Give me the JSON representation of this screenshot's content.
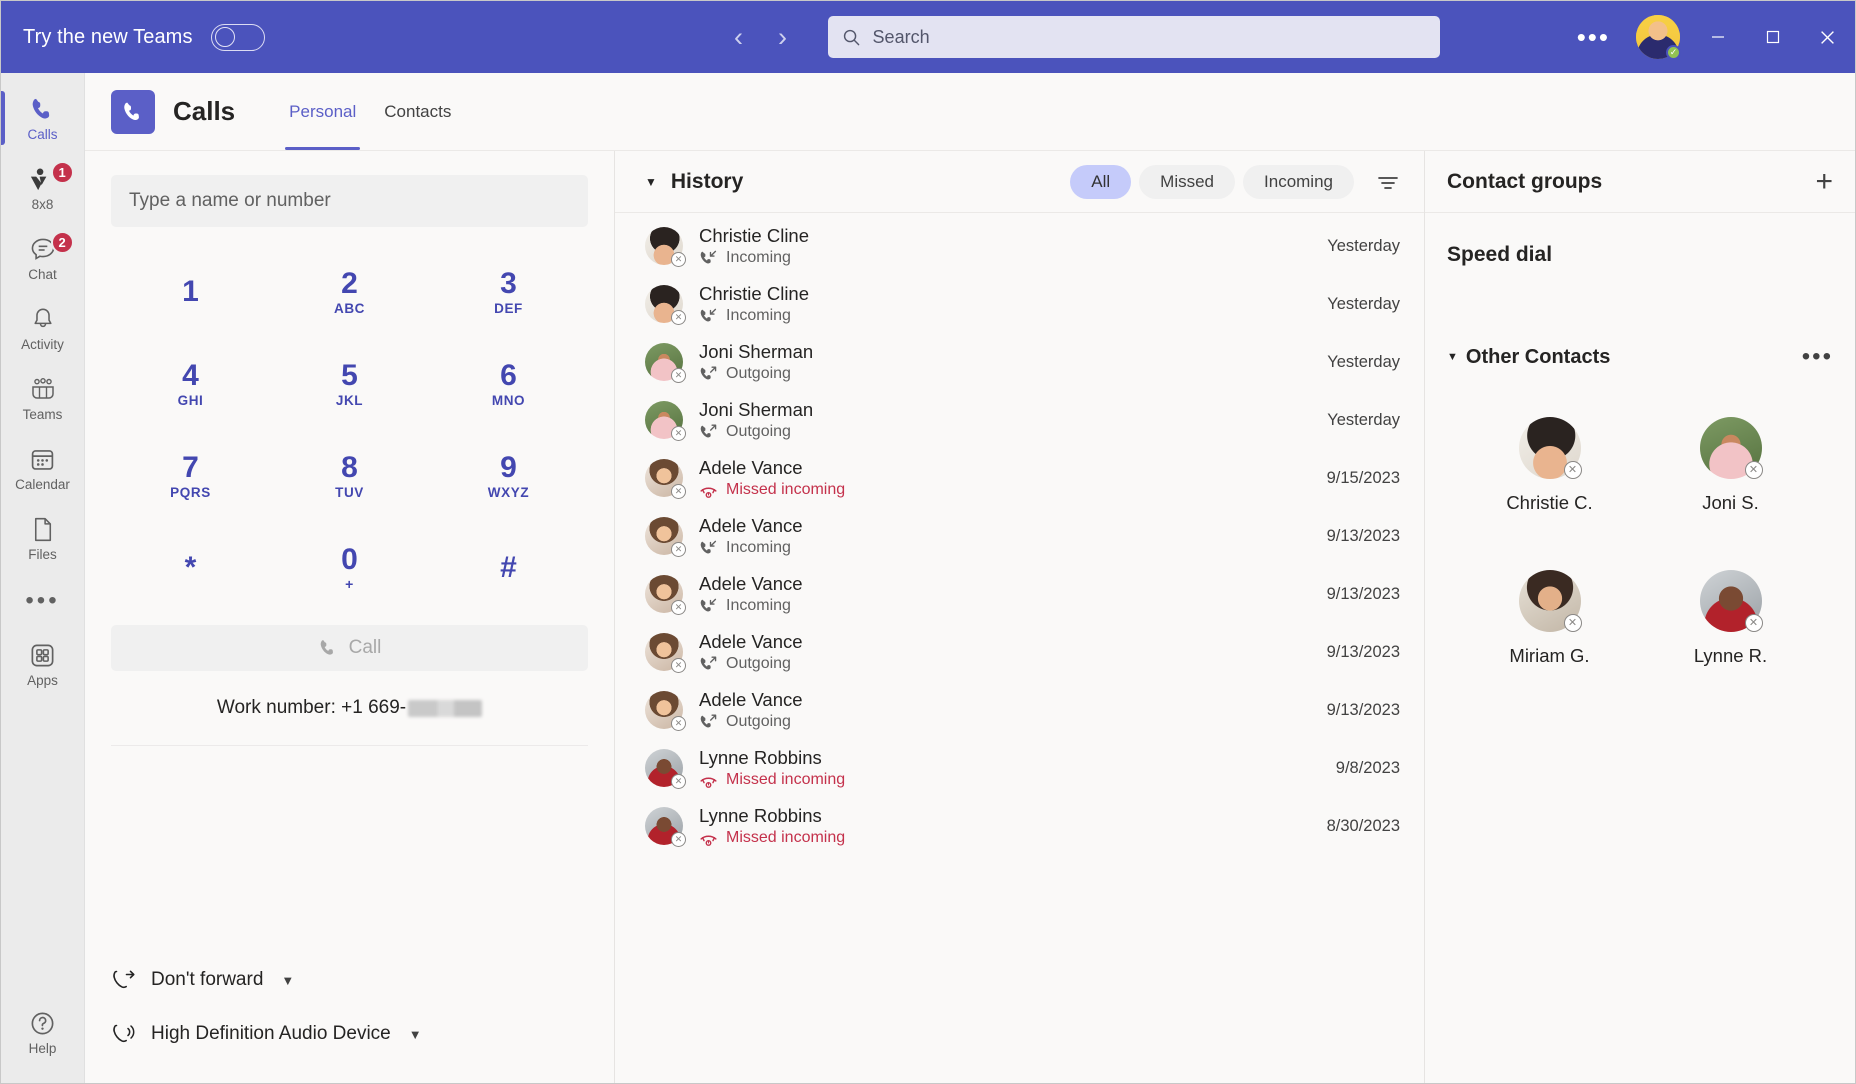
{
  "titlebar": {
    "try_new_label": "Try the new Teams",
    "toggle_state": "off",
    "back_icon": "chevron-left-icon",
    "forward_icon": "chevron-right-icon",
    "search_placeholder": "Search",
    "more_label": "•••",
    "minimize_label": "─",
    "maximize_label": "☐",
    "close_label": "✕",
    "brand_color": "#4b53bc"
  },
  "rail": {
    "items": [
      {
        "label": "Calls",
        "icon": "phone-icon",
        "active": true,
        "badge": ""
      },
      {
        "label": "8x8",
        "icon": "people-icon",
        "active": false,
        "badge": "1"
      },
      {
        "label": "Chat",
        "icon": "chat-icon",
        "active": false,
        "badge": "2"
      },
      {
        "label": "Activity",
        "icon": "bell-icon",
        "active": false,
        "badge": ""
      },
      {
        "label": "Teams",
        "icon": "teams-icon",
        "active": false,
        "badge": ""
      },
      {
        "label": "Calendar",
        "icon": "calendar-icon",
        "active": false,
        "badge": ""
      },
      {
        "label": "Files",
        "icon": "file-icon",
        "active": false,
        "badge": ""
      }
    ],
    "overflow_label": "•••",
    "apps_label": "Apps",
    "help_label": "Help"
  },
  "app_header": {
    "title": "Calls",
    "logo_icon": "phone-icon",
    "tabs": [
      {
        "label": "Personal",
        "active": true
      },
      {
        "label": "Contacts",
        "active": false
      }
    ]
  },
  "dialpad": {
    "input_placeholder": "Type a name or number",
    "input_value": "",
    "keys": [
      {
        "num": "1",
        "sub": ""
      },
      {
        "num": "2",
        "sub": "ABC"
      },
      {
        "num": "3",
        "sub": "DEF"
      },
      {
        "num": "4",
        "sub": "GHI"
      },
      {
        "num": "5",
        "sub": "JKL"
      },
      {
        "num": "6",
        "sub": "MNO"
      },
      {
        "num": "7",
        "sub": "PQRS"
      },
      {
        "num": "8",
        "sub": "TUV"
      },
      {
        "num": "9",
        "sub": "WXYZ"
      },
      {
        "num": "*",
        "sub": ""
      },
      {
        "num": "0",
        "sub": "+"
      },
      {
        "num": "#",
        "sub": ""
      }
    ],
    "call_button_label": "Call",
    "call_button_enabled": false,
    "work_number_label": "Work number: +1 669-",
    "work_number_redacted": true,
    "forwarding_label": "Don't forward",
    "audio_device_label": "High Definition Audio Device"
  },
  "history": {
    "title": "History",
    "filters": [
      {
        "label": "All",
        "active": true
      },
      {
        "label": "Missed",
        "active": false
      },
      {
        "label": "Incoming",
        "active": false
      }
    ],
    "filter_icon": "filter-icon",
    "rows": [
      {
        "name": "Christie Cline",
        "type": "Incoming",
        "missed": false,
        "time": "Yesterday",
        "avatar": "christie"
      },
      {
        "name": "Christie Cline",
        "type": "Incoming",
        "missed": false,
        "time": "Yesterday",
        "avatar": "christie"
      },
      {
        "name": "Joni Sherman",
        "type": "Outgoing",
        "missed": false,
        "time": "Yesterday",
        "avatar": "joni"
      },
      {
        "name": "Joni Sherman",
        "type": "Outgoing",
        "missed": false,
        "time": "Yesterday",
        "avatar": "joni"
      },
      {
        "name": "Adele Vance",
        "type": "Missed incoming",
        "missed": true,
        "time": "9/15/2023",
        "avatar": "adele"
      },
      {
        "name": "Adele Vance",
        "type": "Incoming",
        "missed": false,
        "time": "9/13/2023",
        "avatar": "adele"
      },
      {
        "name": "Adele Vance",
        "type": "Incoming",
        "missed": false,
        "time": "9/13/2023",
        "avatar": "adele"
      },
      {
        "name": "Adele Vance",
        "type": "Outgoing",
        "missed": false,
        "time": "9/13/2023",
        "avatar": "adele"
      },
      {
        "name": "Adele Vance",
        "type": "Outgoing",
        "missed": false,
        "time": "9/13/2023",
        "avatar": "adele"
      },
      {
        "name": "Lynne Robbins",
        "type": "Missed incoming",
        "missed": true,
        "time": "9/8/2023",
        "avatar": "lynne"
      },
      {
        "name": "Lynne Robbins",
        "type": "Missed incoming",
        "missed": true,
        "time": "8/30/2023",
        "avatar": "lynne"
      }
    ]
  },
  "contacts": {
    "title": "Contact groups",
    "add_icon": "plus-icon",
    "speed_dial_label": "Speed dial",
    "other_contacts_label": "Other Contacts",
    "other_more_label": "•••",
    "people": [
      {
        "name": "Christie C.",
        "avatar": "christie",
        "status": "offline"
      },
      {
        "name": "Joni S.",
        "avatar": "joni",
        "status": "offline"
      },
      {
        "name": "Miriam G.",
        "avatar": "miriam",
        "status": "offline"
      },
      {
        "name": "Lynne R.",
        "avatar": "lynne",
        "status": "offline"
      }
    ]
  },
  "colors": {
    "brand": "#4b53bc",
    "accent": "#5b5fc7",
    "missed": "#c4314b",
    "badge": "#c4314b",
    "pill_active": "#c5cbfa"
  }
}
